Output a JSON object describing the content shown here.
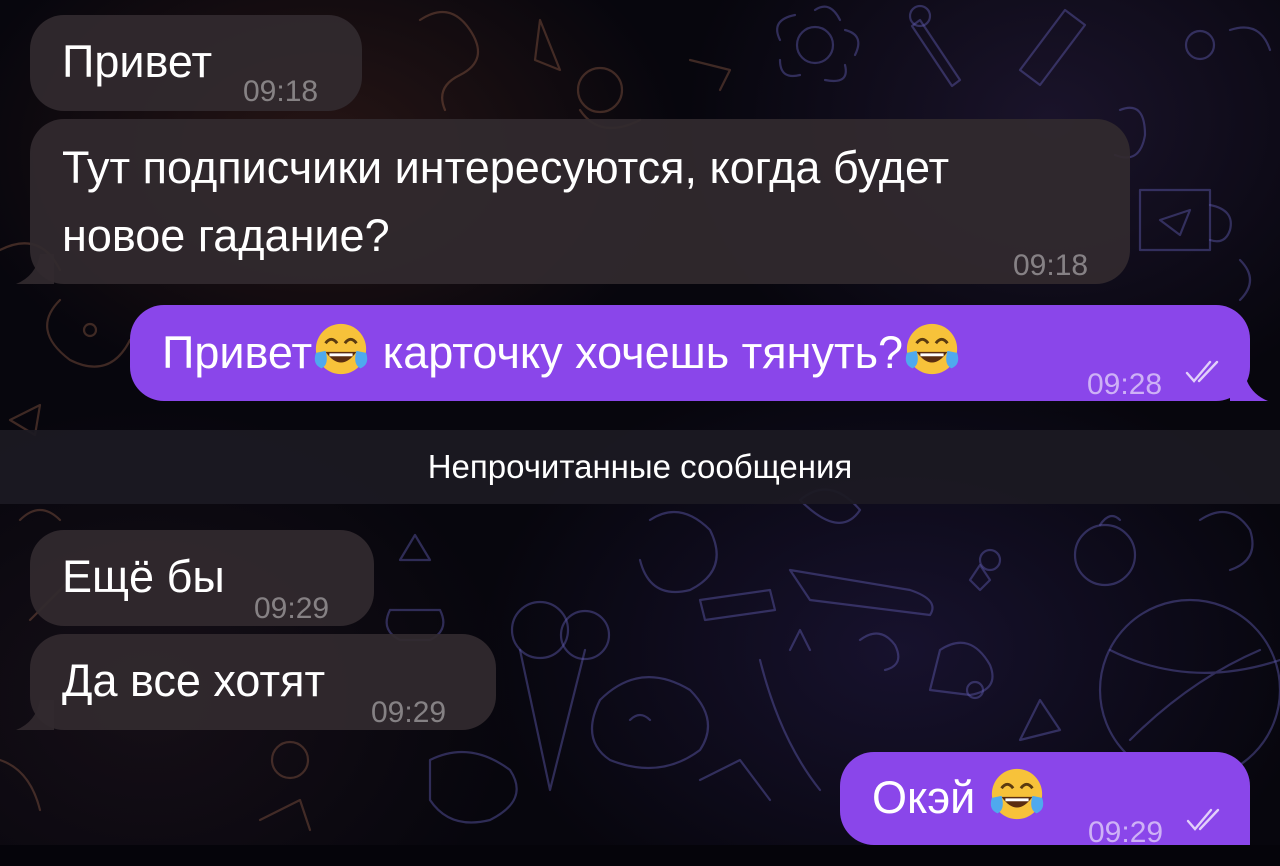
{
  "chat": {
    "messages": [
      {
        "direction": "incoming",
        "text": "Привет",
        "time": "09:18"
      },
      {
        "direction": "incoming",
        "text": "Тут подписчики интересуются, когда будет\nновое гадание?",
        "time": "09:18"
      },
      {
        "direction": "outgoing",
        "text_a": "Привет",
        "text_b": " карточку хочешь тянуть?",
        "emoji": "tears-of-joy-emoji",
        "time": "09:28",
        "status": "read-double-check"
      },
      {
        "direction": "incoming",
        "text": "Ещё бы",
        "time": "09:29"
      },
      {
        "direction": "incoming",
        "text": "Да все хотят",
        "time": "09:29"
      },
      {
        "direction": "outgoing",
        "text": "Окэй ",
        "emoji": "tears-of-joy-emoji",
        "time": "09:29",
        "status": "read-double-check"
      }
    ],
    "unread_divider": "Непрочитанные сообщения"
  },
  "colors": {
    "incoming_bubble": "#322a2e",
    "outgoing_bubble": "#8a46ea",
    "background": "#07060d"
  }
}
